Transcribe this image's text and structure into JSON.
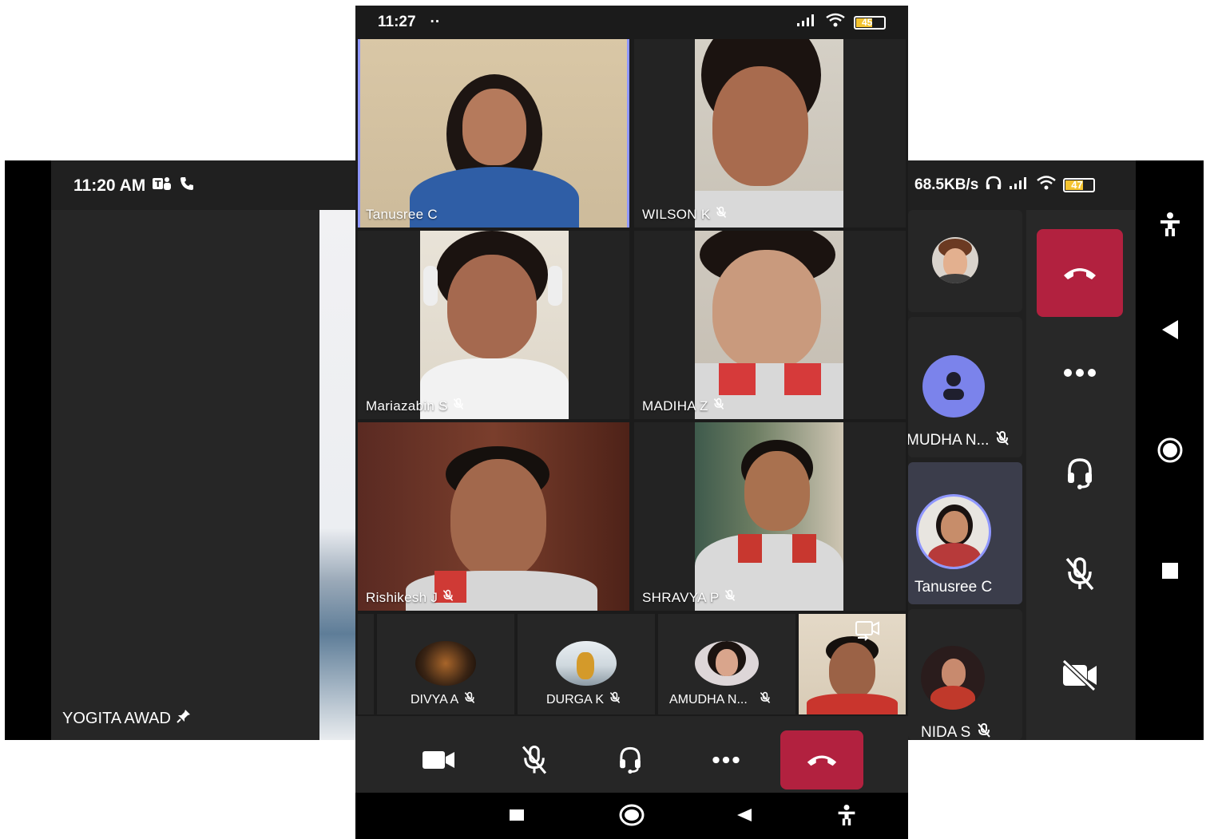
{
  "left_phone": {
    "status_time": "11:20 AM",
    "status_icons": [
      "teams-icon",
      "phone-icon"
    ],
    "pinned_participant": "YOGITA AWAD",
    "pin_icon": "pin-icon"
  },
  "center_phone": {
    "status_time": "11:27",
    "status_dots": "··",
    "battery": "45",
    "video_tiles": [
      {
        "name": "Tanusree C",
        "muted": false,
        "active_speaker": true
      },
      {
        "name": "WILSON K",
        "muted": true
      },
      {
        "name": "Mariazabin S",
        "muted": true
      },
      {
        "name": "MADIHA Z",
        "muted": true
      },
      {
        "name": "Rishikesh J",
        "muted": true
      },
      {
        "name": "SHRAVYA P",
        "muted": true
      }
    ],
    "strip_tiles": [
      {
        "name": "DIVYA A",
        "muted": true
      },
      {
        "name": "DURGA K",
        "muted": true
      },
      {
        "name": "AMUDHA N...",
        "muted": true
      }
    ],
    "controls": [
      "camera-icon",
      "mic-off-icon",
      "headset-icon",
      "more-icon",
      "hangup-icon"
    ],
    "nav": [
      "square-icon",
      "circle-icon",
      "back-icon",
      "accessibility-icon"
    ]
  },
  "right_phone": {
    "status_speed": "68.5KB/s",
    "battery": "47",
    "participants": [
      {
        "name": "",
        "kind": "avatar-photo"
      },
      {
        "name": "MUDHA N...",
        "muted": true,
        "kind": "avatar-default"
      },
      {
        "name": "Tanusree C",
        "active": true,
        "kind": "avatar-photo"
      },
      {
        "name": "NIDA S",
        "muted": true,
        "kind": "avatar-photo"
      }
    ],
    "controls": [
      "hangup-icon",
      "more-icon",
      "headset-icon",
      "mic-off-icon",
      "camera-off-icon"
    ],
    "nav": [
      "accessibility-icon",
      "back-icon",
      "circle-icon",
      "square-icon"
    ]
  },
  "colors": {
    "hangup": "#b2213f",
    "active_border": "#8f97ff",
    "default_avatar": "#7b83eb",
    "background": "#202020"
  }
}
